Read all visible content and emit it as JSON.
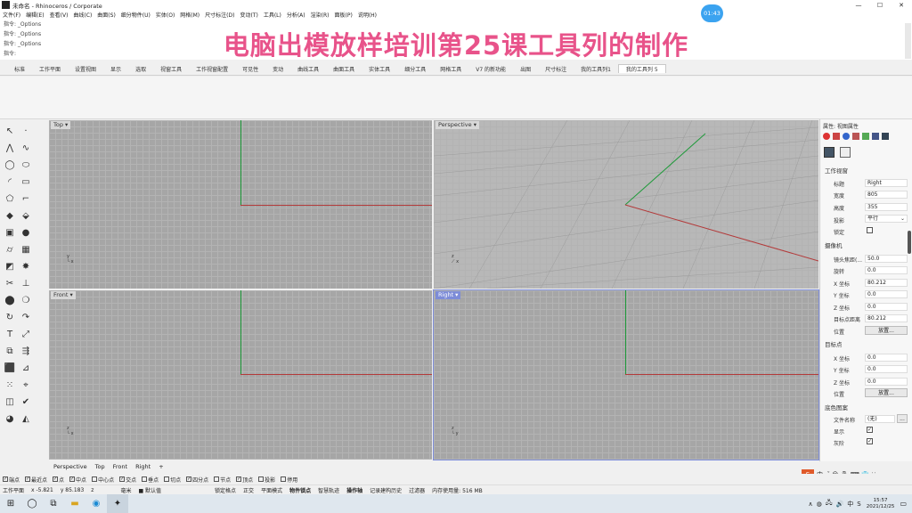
{
  "window": {
    "title": "未命名 - Rhinoceros / Corporate",
    "controls": [
      "—",
      "☐",
      "✕"
    ]
  },
  "menu": [
    "文件(F)",
    "编辑(E)",
    "查看(V)",
    "曲线(C)",
    "曲面(S)",
    "细分物件(U)",
    "实体(O)",
    "网格(M)",
    "尺寸标注(D)",
    "变动(T)",
    "工具(L)",
    "分析(A)",
    "渲染(R)",
    "面板(P)",
    "说明(H)"
  ],
  "command_history": [
    "指令: _Options",
    "指令: _Options",
    "指令: _Options",
    "指令:"
  ],
  "banner": "电脑出模放样培训第25课工具列的制作",
  "clock_badge": "01:43",
  "toolbar_tabs": [
    "标准",
    "工作平面",
    "设置视图",
    "显示",
    "选取",
    "视窗工具",
    "工作视窗配置",
    "可见性",
    "变动",
    "曲线工具",
    "曲面工具",
    "实体工具",
    "细分工具",
    "网格工具",
    "V7 的新功能",
    "出图",
    "尺寸标注",
    "我的工具列1",
    "我的工具列 5"
  ],
  "active_tab_index": 18,
  "viewports": {
    "top": {
      "label": "Top ▾"
    },
    "perspective": {
      "label": "Perspective ▾"
    },
    "front": {
      "label": "Front ▾"
    },
    "right": {
      "label": "Right ▾"
    }
  },
  "viewport_tabs": [
    "Perspective",
    "Top",
    "Front",
    "Right",
    "+"
  ],
  "properties": {
    "header": "属性: 视图属性",
    "section_viewport": "工作视窗",
    "title_label": "标题",
    "title_value": "Right",
    "width_label": "宽度",
    "width_value": "805",
    "height_label": "高度",
    "height_value": "355",
    "projection_label": "投影",
    "projection_value": "平行",
    "locked_label": "锁定",
    "section_camera": "摄像机",
    "lens_label": "镜头焦距(...",
    "lens_value": "50.0",
    "rotation_label": "旋转",
    "rotation_value": "0.0",
    "cx_label": "X 坐标",
    "cx_value": "80.212",
    "cy_label": "Y 坐标",
    "cy_value": "0.0",
    "cz_label": "Z 坐标",
    "cz_value": "0.0",
    "distance_label": "目标点距离",
    "distance_value": "80.212",
    "position_label": "位置",
    "position_button": "放置...",
    "section_target": "目标点",
    "tx_label": "X 坐标",
    "tx_value": "0.0",
    "ty_label": "Y 坐标",
    "ty_value": "0.0",
    "tz_label": "Z 坐标",
    "tz_value": "0.0",
    "tpos_label": "位置",
    "tpos_button": "放置...",
    "section_wallpaper": "底色图案",
    "filename_label": "文件名称",
    "filename_value": "(无)",
    "show_label": "显示",
    "gray_label": "灰阶"
  },
  "osnaps": [
    {
      "label": "端点",
      "checked": true
    },
    {
      "label": "最近点",
      "checked": true
    },
    {
      "label": "点",
      "checked": true
    },
    {
      "label": "中点",
      "checked": true
    },
    {
      "label": "中心点",
      "checked": false
    },
    {
      "label": "交点",
      "checked": true
    },
    {
      "label": "垂点",
      "checked": false
    },
    {
      "label": "切点",
      "checked": false
    },
    {
      "label": "四分点",
      "checked": true
    },
    {
      "label": "节点",
      "checked": false
    },
    {
      "label": "顶点",
      "checked": true
    },
    {
      "label": "投影",
      "checked": false
    },
    {
      "label": "停用",
      "checked": false
    }
  ],
  "status": {
    "cplane": "工作平面",
    "x": "x -5.821",
    "y": "y 85.183",
    "z": "z",
    "unit": "毫米",
    "layer": "■ 默认值",
    "modes": [
      "锁定格点",
      "正交",
      "平面模式",
      "物件锁点",
      "智慧轨迹",
      "操作轴",
      "记录建构历史",
      "过滤器",
      "内存使用量: 516 MB"
    ]
  },
  "taskbar": {
    "time": "15:57",
    "date": "2021/12/25"
  },
  "colors": {
    "accent_red": "#b33a3a",
    "accent_green": "#1f9a3a",
    "banner": "#e8538a",
    "active_label": "#7d8cd8"
  }
}
